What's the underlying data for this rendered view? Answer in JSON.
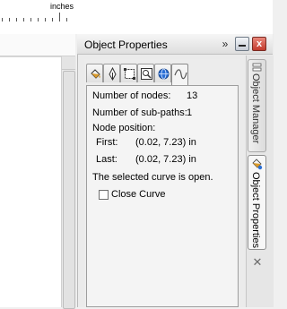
{
  "ruler": {
    "units": "inches"
  },
  "docker": {
    "title": "Object Properties",
    "expand_icon": "double-chevron-right-icon",
    "minimize_icon": "minimize-icon",
    "close_icon": "close-icon",
    "close_glyph": "x"
  },
  "tabs": [
    {
      "name": "fill-tab",
      "icon": "paint-bucket-icon",
      "active": false
    },
    {
      "name": "outline-tab",
      "icon": "pen-nib-icon",
      "active": false
    },
    {
      "name": "general-tab",
      "icon": "frame-icon",
      "active": false
    },
    {
      "name": "summary-tab",
      "icon": "magnifier-frame-icon",
      "active": false
    },
    {
      "name": "internet-tab",
      "icon": "globe-icon",
      "active": false
    },
    {
      "name": "curve-tab",
      "icon": "curve-icon",
      "active": true
    }
  ],
  "curve": {
    "nodes_label": "Number of nodes:",
    "nodes_value": "13",
    "subpaths_label": "Number of sub-paths:",
    "subpaths_value": "1",
    "node_position_label": "Node position:",
    "first_label": "First:",
    "first_value": "(0.02, 7.23) in",
    "last_label": "Last:",
    "last_value": "(0.02, 7.23) in",
    "status": "The selected curve is open.",
    "close_curve_label": "Close Curve",
    "close_curve_checked": false
  },
  "side_tabs": {
    "object_manager": "Object Manager",
    "object_properties": "Object Properties",
    "close_glyph": "✕"
  },
  "colors": {
    "close_button": "#c33a2c",
    "globe": "#2a6fd6",
    "bucket": "#d99a2b"
  }
}
